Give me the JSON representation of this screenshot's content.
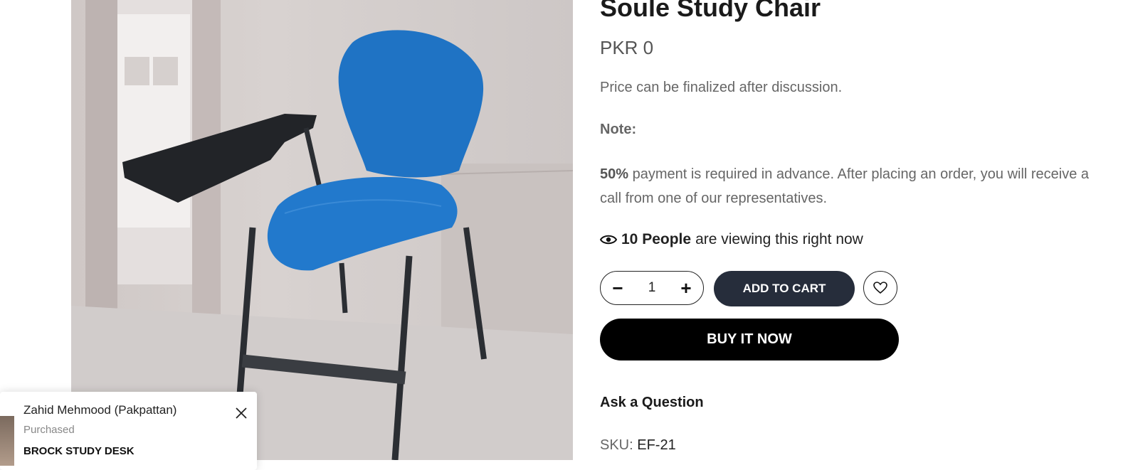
{
  "product": {
    "title": "Soule Study Chair",
    "price": "PKR 0",
    "price_note": "Price can be finalized after discussion.",
    "note_label": "Note:",
    "advance_percent": "50%",
    "advance_text": " payment is required in advance. After placing an order, you will receive a call from one of our representatives.",
    "viewers_count": "10 People",
    "viewers_text": "are viewing this right now",
    "quantity": "1",
    "add_to_cart_label": "ADD TO CART",
    "buy_now_label": "BUY IT NOW",
    "ask_question_label": "Ask a Question",
    "sku_label": "SKU:",
    "sku_value": "EF-21"
  },
  "qty_controls": {
    "minus": "−",
    "plus": "+"
  },
  "popup": {
    "buyer": "Zahid Mehmood (Pakpattan)",
    "status": "Purchased",
    "product_name": "BROCK STUDY DESK"
  },
  "icons": {
    "viewers": "eye-icon",
    "wishlist": "heart-icon",
    "close": "close-icon"
  },
  "colors": {
    "chair_seat": "#1f73c4",
    "add_to_cart_bg": "#262d3b",
    "buy_now_bg": "#000000"
  }
}
